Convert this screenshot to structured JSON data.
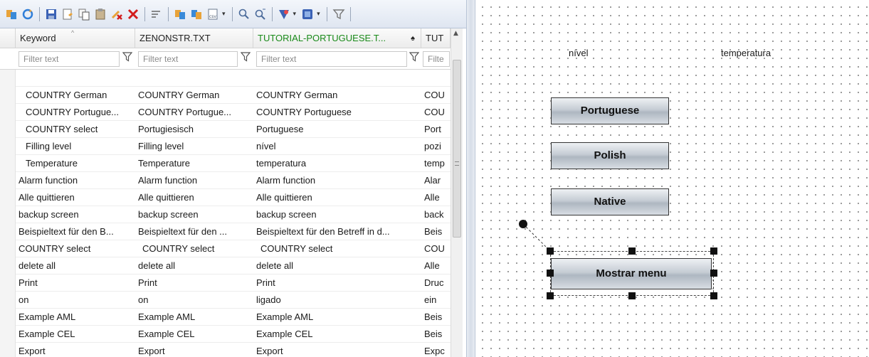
{
  "grid": {
    "columns": [
      {
        "label": "Keyword",
        "filter": "Filter text"
      },
      {
        "label": "ZENONSTR.TXT",
        "filter": "Filter text"
      },
      {
        "label": "TUTORIAL-PORTUGUESE.T...",
        "filter": "Filter text"
      },
      {
        "label": "TUT",
        "filter": "Filte"
      }
    ],
    "rows": [
      [
        "",
        "",
        "",
        ""
      ],
      [
        "COUNTRY German",
        "COUNTRY German",
        "COUNTRY German",
        "COU"
      ],
      [
        "COUNTRY Portugue...",
        "COUNTRY Portugue...",
        "COUNTRY Portuguese",
        "COU"
      ],
      [
        "COUNTRY select",
        "Portugiesisch",
        "Portuguese",
        "Port"
      ],
      [
        "Filling level",
        "Filling level",
        "nível",
        "pozi"
      ],
      [
        "Temperature",
        "Temperature",
        "temperatura",
        "temp"
      ],
      [
        "Alarm function",
        "Alarm function",
        "Alarm function",
        "Alar"
      ],
      [
        "Alle quittieren",
        "Alle quittieren",
        "Alle quittieren",
        "Alle"
      ],
      [
        "backup screen",
        "backup screen",
        "backup screen",
        "back"
      ],
      [
        "Beispieltext für den B...",
        "Beispieltext für den ...",
        "Beispieltext für den Betreff in d...",
        "Beis"
      ],
      [
        "COUNTRY select",
        "COUNTRY select",
        "COUNTRY select",
        "COU"
      ],
      [
        "delete all",
        "delete all",
        "delete all",
        "Alle"
      ],
      [
        "Print",
        "Print",
        "Print",
        "Druc"
      ],
      [
        "on",
        "on",
        "ligado",
        "ein"
      ],
      [
        "Example AML",
        "Example AML",
        "Example AML",
        "Beis"
      ],
      [
        "Example CEL",
        "Example CEL",
        "Example CEL",
        "Beis"
      ],
      [
        "Export",
        "Export",
        "Export",
        "Expc"
      ]
    ]
  },
  "canvas": {
    "labels": {
      "level": "nível",
      "temperature": "temperatura"
    },
    "buttons": {
      "portuguese": "Portuguese",
      "polish": "Polish",
      "native": "Native",
      "menu": "Mostrar menu"
    }
  },
  "colors": {
    "highlight_header": "#1a8a1a",
    "toolbar_top": "#f3f6fb",
    "toolbar_bottom": "#dfe6f1"
  }
}
